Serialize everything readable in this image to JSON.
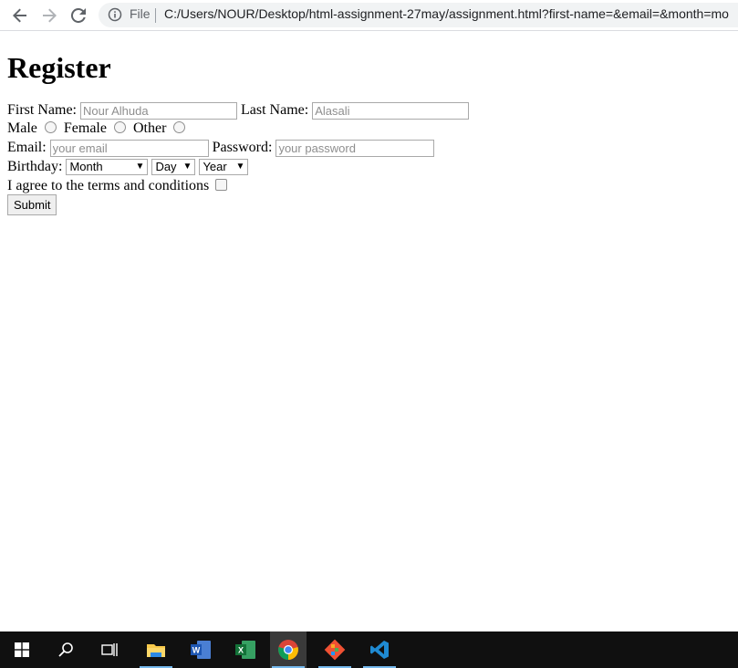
{
  "browser": {
    "scheme_label": "File",
    "url": "C:/Users/NOUR/Desktop/html-assignment-27may/assignment.html?first-name=&email=&month=mo"
  },
  "form": {
    "title": "Register",
    "first_name": {
      "label": "First Name:",
      "placeholder": "Nour Alhuda"
    },
    "last_name": {
      "label": "Last Name:",
      "placeholder": "Alasali"
    },
    "gender": {
      "options": [
        "Male",
        "Female",
        "Other"
      ]
    },
    "email": {
      "label": "Email:",
      "placeholder": "your email"
    },
    "password": {
      "label": "Password:",
      "placeholder": "your password"
    },
    "birthday": {
      "label": "Birthday:",
      "month": "Month",
      "day": "Day",
      "year": "Year"
    },
    "terms_label": "I agree to the terms and conditions",
    "submit_label": "Submit"
  },
  "taskbar": {
    "items": [
      "windows-start-icon",
      "search-icon",
      "task-view-icon",
      "file-explorer-icon",
      "word-icon",
      "excel-icon",
      "chrome-icon",
      "git-icon",
      "vscode-icon"
    ]
  },
  "colors": {
    "accent_underline": "#76b9ed",
    "taskbar_bg": "#101010"
  }
}
